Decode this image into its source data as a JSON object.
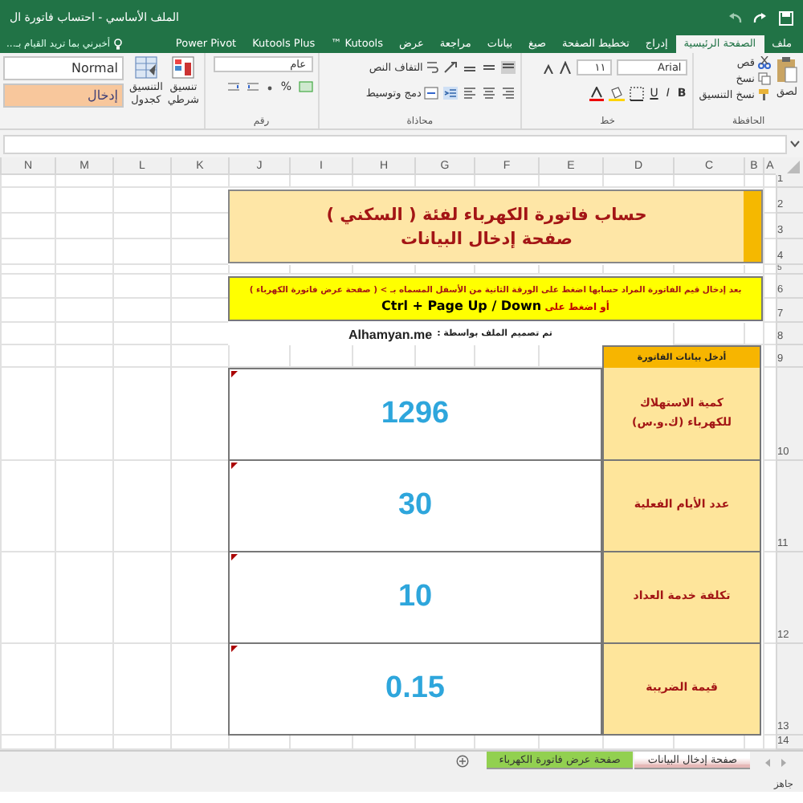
{
  "window": {
    "title": "الملف الأساسي - احتساب فاتورة ال"
  },
  "ribbon_tabs": [
    {
      "label": "ملف",
      "selected": false
    },
    {
      "label": "الصفحة الرئيسية",
      "selected": true
    },
    {
      "label": "إدراج",
      "selected": false
    },
    {
      "label": "تخطيط الصفحة",
      "selected": false
    },
    {
      "label": "صيغ",
      "selected": false
    },
    {
      "label": "بيانات",
      "selected": false
    },
    {
      "label": "مراجعة",
      "selected": false
    },
    {
      "label": "عرض",
      "selected": false
    },
    {
      "label": "Kutools ™",
      "selected": false
    },
    {
      "label": "Kutools Plus",
      "selected": false
    },
    {
      "label": "Power Pivot",
      "selected": false
    }
  ],
  "tell_me": {
    "placeholder": "أخبرني بما تريد القيام بـ..."
  },
  "ribbon": {
    "clipboard": {
      "paste": "لصق",
      "cut": "قص",
      "copy": "نسخ",
      "format_painter": "نسخ التنسيق",
      "label": "الحافظة"
    },
    "font": {
      "name": "Arial",
      "size": "١١",
      "bold": "B",
      "italic": "I",
      "underline": "U",
      "label": "خط"
    },
    "alignment": {
      "wrap": "التفاف النص",
      "merge": "دمج وتوسيط",
      "label": "محاذاة"
    },
    "number": {
      "format": "عام",
      "percent": "%",
      "label": "رقم"
    },
    "styles": {
      "conditional": "تنسيق شرطي",
      "as_table": "التنسيق كجدول",
      "normal": "Normal",
      "input": "إدخال"
    }
  },
  "columns": [
    "A",
    "B",
    "C",
    "D",
    "E",
    "F",
    "G",
    "H",
    "I",
    "J",
    "K",
    "L",
    "M",
    "N"
  ],
  "rows": [
    "1",
    "2",
    "3",
    "4",
    "5",
    "6",
    "7",
    "8",
    "9",
    "10",
    "11",
    "12",
    "13",
    "14"
  ],
  "sheet": {
    "title": "حساب فاتورة الكهرباء لفئة ( السكني )",
    "subtitle": "صفحة إدخال البيانات",
    "note_line_1": "بعد إدخال قيم الفاتورة المراد حسابها اضغط على الورقة الثانية من الأسفل المسماه بـ > ( صفحة عرض فاتورة الكهرباء )",
    "note_line_2": "أو اضغط على **Ctrl + Page Up / Down**",
    "credit": "تم تصميم الملف بواسطة : **Alhamyan.me**",
    "input_header": "أدخل بيانات الفاتورة",
    "inputs": [
      {
        "label": "كمية الاستهلاك للكهرباء (ك.و.س)",
        "value": "1296"
      },
      {
        "label": "عدد الأيام الفعلية",
        "value": "30"
      },
      {
        "label": "تكلفة خدمة العداد",
        "value": "10"
      },
      {
        "label": "قيمة الضريبة",
        "value": "0.15"
      }
    ]
  },
  "sheet_tabs": [
    {
      "label": "صفحة إدخال البيانات",
      "selected": true,
      "color": "#e6b8b7"
    },
    {
      "label": "صفحة عرض فاتورة الكهرباء",
      "selected": false,
      "color": "#92d050"
    }
  ],
  "status_bar": {
    "text": "جاهز"
  }
}
